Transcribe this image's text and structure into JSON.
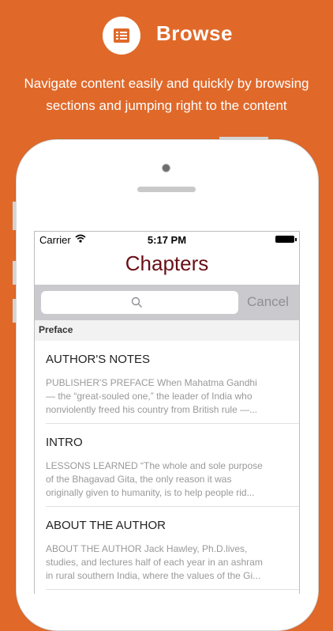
{
  "promo": {
    "title": "Browse",
    "subtitle_line1": "Navigate content easily and quickly by browsing",
    "subtitle_line2": "sections and jumping right to the content",
    "icon": "list-icon"
  },
  "status_bar": {
    "carrier": "Carrier",
    "time": "5:17 PM"
  },
  "nav": {
    "title": "Chapters"
  },
  "search": {
    "placeholder": "",
    "cancel_label": "Cancel"
  },
  "section": {
    "header": "Preface"
  },
  "chapters": [
    {
      "title": "AUTHOR'S NOTES",
      "body": "PUBLISHER'S PREFACE When Mahatma Gandhi\n— the “great-souled one,” the leader of India who\nnonviolently freed his country from British rule —..."
    },
    {
      "title": "INTRO",
      "body": "LESSONS LEARNED “The whole and sole purpose\nof the Bhagavad Gita, the only reason it was\noriginally given to humanity, is to help people rid..."
    },
    {
      "title": "ABOUT THE AUTHOR",
      "body": "ABOUT THE AUTHOR     Jack Hawley, Ph.D.lives,\nstudies, and lectures half of each year in an ashram\nin rural southern India, where the values of the Gi..."
    }
  ],
  "colors": {
    "background": "#e0692a",
    "nav_title": "#6a0f16"
  }
}
